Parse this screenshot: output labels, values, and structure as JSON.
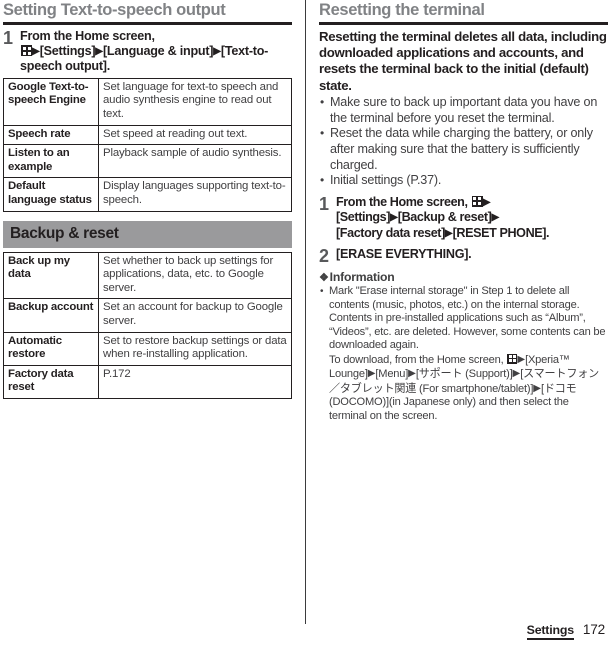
{
  "page": {
    "footer_chapter": "Settings",
    "footer_page": "172"
  },
  "left": {
    "heading": "Setting Text-to-speech output",
    "step1": {
      "number": "1",
      "line1": "From the Home screen,",
      "icon": "app-grid-icon",
      "after_icon": "[Settings]",
      "part2": "[Language & input]",
      "part3": "[Text-to-speech output]."
    },
    "tts_table": {
      "rows": [
        {
          "key": "Google Text-to-speech Engine",
          "value": "Set language for text-to speech and audio synthesis engine to read out text."
        },
        {
          "key": "Speech rate",
          "value": "Set speed at reading out text."
        },
        {
          "key": "Listen to an example",
          "value": "Playback sample of audio synthesis."
        },
        {
          "key": "Default language status",
          "value": "Display languages supporting text-to-speech."
        }
      ]
    },
    "band_heading": "Backup & reset",
    "backup_table": {
      "rows": [
        {
          "key": "Back up my data",
          "value": "Set whether to back up settings for applications, data, etc. to Google server."
        },
        {
          "key": "Backup account",
          "value": "Set an account for backup to Google server."
        },
        {
          "key": "Automatic restore",
          "value": "Set to restore backup settings or data when re-installing application."
        },
        {
          "key": "Factory data reset",
          "value": "P.172"
        }
      ]
    }
  },
  "right": {
    "heading": "Resetting the terminal",
    "intro": "Resetting the terminal deletes all data, including downloaded applications and accounts, and resets the terminal back to the initial (default) state.",
    "bullets": [
      "Make sure to back up important data you have on the terminal before you reset the terminal.",
      "Reset the data while charging the battery, or only after making sure that the battery is sufficiently charged.",
      "Initial settings (P.37)."
    ],
    "step1": {
      "number": "1",
      "line1": "From the Home screen,",
      "icon": "app-grid-icon",
      "part1": "[Settings]",
      "part2": "[Backup & reset]",
      "part3": "[Factory data reset]",
      "part4": "[RESET PHONE]."
    },
    "step2": {
      "number": "2",
      "text": "[ERASE EVERYTHING]."
    },
    "info": {
      "symbol": "❖",
      "title": "Information",
      "items": [
        {
          "text_a": "Mark \"Erase internal storage\" in Step 1 to delete all contents (music, photos, etc.) on the internal storage. Contents in pre-installed applications such as “Album”, “Videos”, etc. are deleted. However, some contents can be downloaded again.",
          "text_b": "To download, from the Home screen,",
          "icon": "app-grid-icon",
          "text_c": "[Xperia™ Lounge]",
          "text_d": "[Menu]",
          "text_e": "[サポート (Support)]",
          "text_f": "[スマートフォン／タブレット関連 (For smartphone/tablet)]",
          "text_g": "[ドコモ (DOCOMO)](in Japanese only) and then select the terminal on the screen."
        }
      ]
    }
  },
  "arrow_glyph": "▶"
}
